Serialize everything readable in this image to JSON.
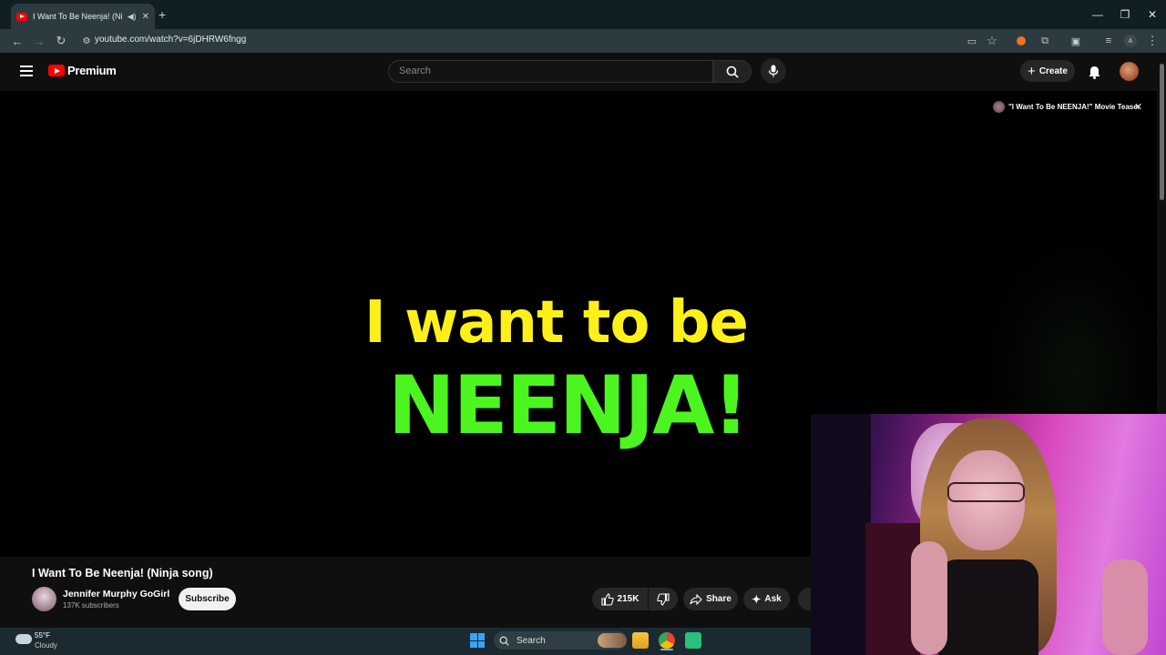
{
  "browser": {
    "tab_title": "I Want To Be Neenja! (Ninja",
    "url": "youtube.com/watch?v=6jDHRW6fngg"
  },
  "header": {
    "logo_text": "Premium",
    "search_placeholder": "Search",
    "create_label": "Create"
  },
  "video": {
    "line1": "I want to be",
    "line2": "NEENJA!",
    "teaser_label": "\"I Want To Be NEENJA!\" Movie Teaser"
  },
  "info": {
    "title": "I Want To Be Neenja! (Ninja song)",
    "channel_name": "Jennifer Murphy GoGirl",
    "subscribers": "137K subscribers",
    "subscribe_label": "Subscribe",
    "like_count": "215K",
    "share_label": "Share",
    "ask_label": "Ask"
  },
  "taskbar": {
    "temperature": "55°F",
    "condition": "Cloudy",
    "search_label": "Search"
  },
  "colors": {
    "youtube_red": "#ff0000",
    "line1_yellow": "#fdf01a",
    "line2_green": "#4cf51f"
  }
}
